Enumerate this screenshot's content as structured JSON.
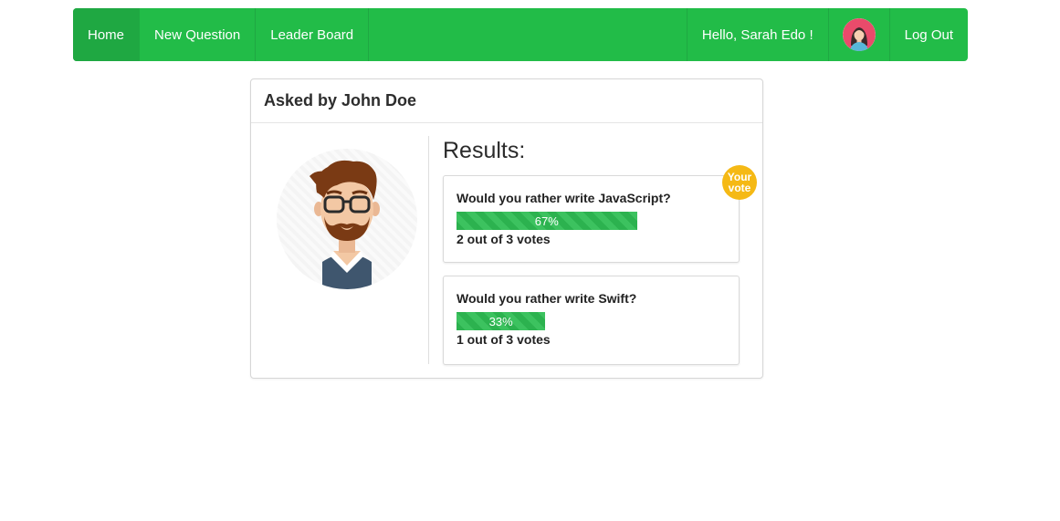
{
  "nav": {
    "home": "Home",
    "new_question": "New Question",
    "leader_board": "Leader Board",
    "greeting": "Hello, Sarah Edo !",
    "logout": "Log Out",
    "avatar_icon": "user-avatar-woman-icon"
  },
  "question": {
    "asked_by": "Asked by John Doe",
    "author_avatar_icon": "author-avatar-man-icon",
    "results_title": "Results:",
    "options": [
      {
        "text": "Would you rather write JavaScript?",
        "percent": 67,
        "percent_label": "67%",
        "votes_label": "2 out of 3 votes",
        "user_vote": true,
        "badge": "Your vote"
      },
      {
        "text": "Would you rather write Swift?",
        "percent": 33,
        "percent_label": "33%",
        "votes_label": "1 out of 3 votes",
        "user_vote": false
      }
    ]
  },
  "colors": {
    "brand": "#22bc48",
    "progress": "#2cb24f",
    "badge": "#f5b915"
  }
}
